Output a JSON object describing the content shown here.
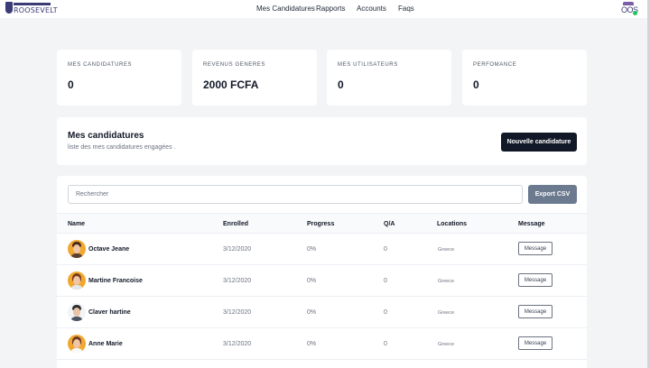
{
  "brand": {
    "name": "ROOSEVELT"
  },
  "nav": {
    "items": [
      "Mes Candidatures",
      "Rapports",
      "Accounts",
      "Faqs"
    ]
  },
  "user_mark": {
    "text": "OOS"
  },
  "stats": [
    {
      "label": "MES CANDIDATURES",
      "value": "0"
    },
    {
      "label": "REVENUS GENERES",
      "value": "2000 FCFA"
    },
    {
      "label": "MES UTILISATEURS",
      "value": "0"
    },
    {
      "label": "PERFOMANCE",
      "value": "0"
    }
  ],
  "section": {
    "title": "Mes candidatures",
    "subtitle": "liste des mes candidatures engagées .",
    "new_button": "Nouvelle candidature"
  },
  "search": {
    "placeholder": "Rechercher"
  },
  "export_button": "Export CSV",
  "table": {
    "columns": [
      "Name",
      "Enrolled",
      "Progress",
      "Q/A",
      "Locations",
      "Message"
    ],
    "rows": [
      {
        "name": "Octave Jeane",
        "enrolled": "3/12/2020",
        "progress": "0%",
        "qa": "0",
        "location": "Greece",
        "action": "Message"
      },
      {
        "name": "Martine Francoise",
        "enrolled": "3/12/2020",
        "progress": "0%",
        "qa": "0",
        "location": "Greece",
        "action": "Message"
      },
      {
        "name": "Claver hartine",
        "enrolled": "3/12/2020",
        "progress": "0%",
        "qa": "0",
        "location": "Greece",
        "action": "Message"
      },
      {
        "name": "Anne Marie",
        "enrolled": "3/12/2020",
        "progress": "0%",
        "qa": "0",
        "location": "Greece",
        "action": "Message"
      }
    ]
  },
  "colors": {
    "brand": "#3b3b78",
    "primary_button": "#111827",
    "export_button": "#6b7a8f",
    "page_bg": "#f3f4f6"
  }
}
